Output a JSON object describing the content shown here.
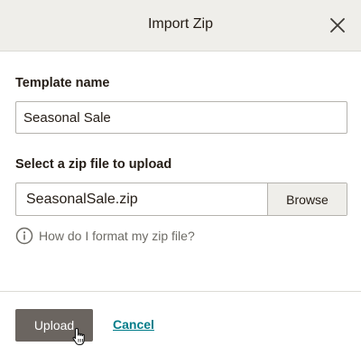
{
  "modal": {
    "title": "Import Zip",
    "close_icon": "close-icon"
  },
  "template_name": {
    "label": "Template name",
    "value": "Seasonal Sale"
  },
  "zip_file": {
    "label": "Select a zip file to upload",
    "file_name": "SeasonalSale.zip",
    "browse_label": "Browse"
  },
  "help": {
    "icon": "info-icon",
    "text": "How do I format my zip file?"
  },
  "footer": {
    "upload_label": "Upload",
    "cancel_label": "Cancel"
  },
  "colors": {
    "header_bg": "#efeeea",
    "upload_bg": "#6b6560",
    "link": "#007c89"
  }
}
